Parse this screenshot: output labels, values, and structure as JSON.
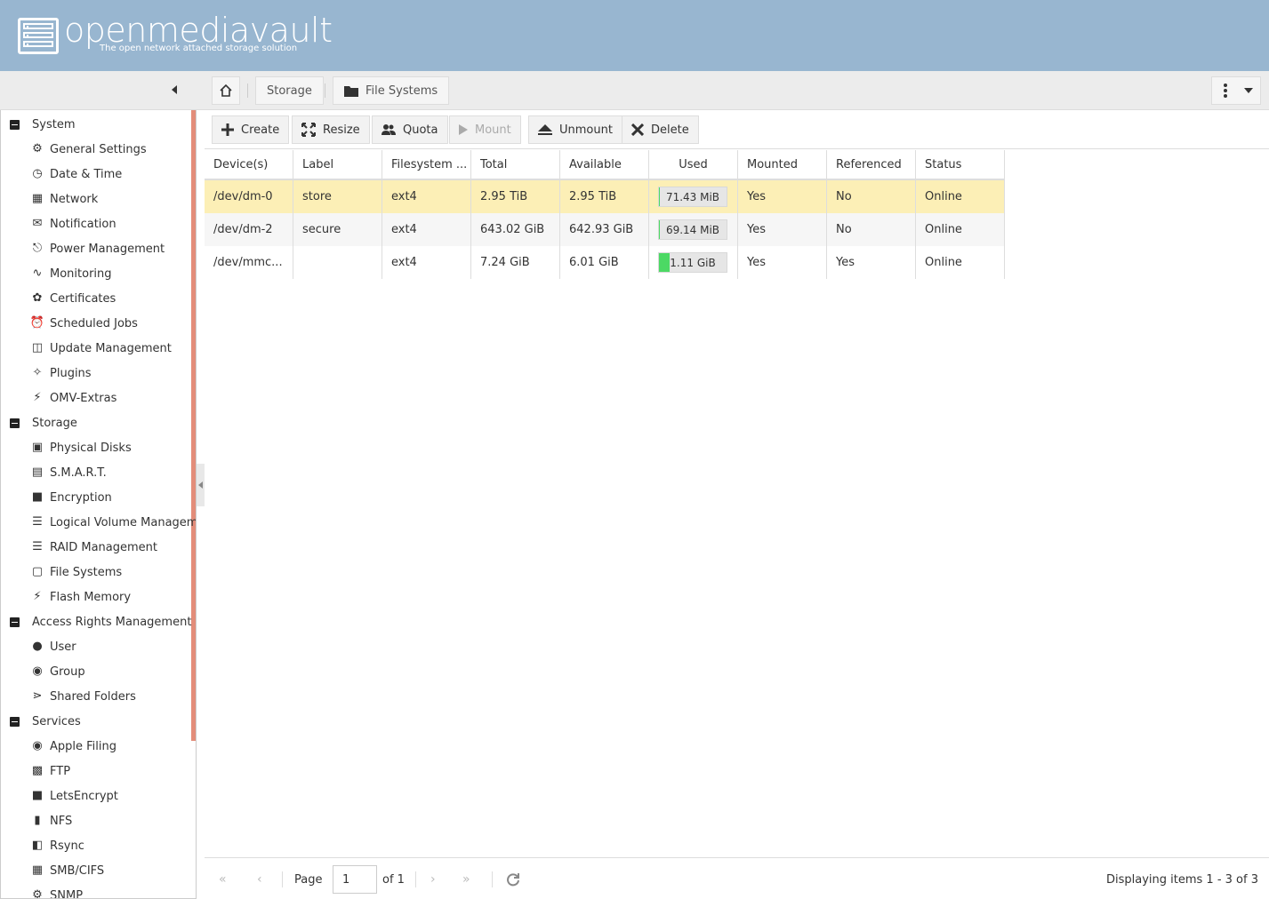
{
  "header": {
    "title": "openmediavault",
    "subtitle": "The open network attached storage solution"
  },
  "breadcrumb": {
    "home_icon": "home-icon",
    "items": [
      "Storage",
      "File Systems"
    ]
  },
  "sidebar": {
    "categories": [
      {
        "label": "System",
        "items": [
          {
            "label": "General Settings",
            "icon": "gears-icon"
          },
          {
            "label": "Date & Time",
            "icon": "clock-icon"
          },
          {
            "label": "Network",
            "icon": "network-icon"
          },
          {
            "label": "Notification",
            "icon": "envelope-icon"
          },
          {
            "label": "Power Management",
            "icon": "power-icon"
          },
          {
            "label": "Monitoring",
            "icon": "chart-line-icon"
          },
          {
            "label": "Certificates",
            "icon": "certificate-icon"
          },
          {
            "label": "Scheduled Jobs",
            "icon": "alarm-clock-icon"
          },
          {
            "label": "Update Management",
            "icon": "update-icon"
          },
          {
            "label": "Plugins",
            "icon": "puzzle-icon"
          },
          {
            "label": "OMV-Extras",
            "icon": "plug-icon"
          }
        ]
      },
      {
        "label": "Storage",
        "items": [
          {
            "label": "Physical Disks",
            "icon": "hdd-icon"
          },
          {
            "label": "S.M.A.R.T.",
            "icon": "smart-icon"
          },
          {
            "label": "Encryption",
            "icon": "lock-icon"
          },
          {
            "label": "Logical Volume Managem",
            "icon": "database-icon"
          },
          {
            "label": "RAID Management",
            "icon": "database-icon"
          },
          {
            "label": "File Systems",
            "icon": "folder-icon"
          },
          {
            "label": "Flash Memory",
            "icon": "flash-icon"
          }
        ]
      },
      {
        "label": "Access Rights Management",
        "items": [
          {
            "label": "User",
            "icon": "user-icon"
          },
          {
            "label": "Group",
            "icon": "group-icon"
          },
          {
            "label": "Shared Folders",
            "icon": "share-icon"
          }
        ]
      },
      {
        "label": "Services",
        "items": [
          {
            "label": "Apple Filing",
            "icon": "apple-icon"
          },
          {
            "label": "FTP",
            "icon": "ftp-icon"
          },
          {
            "label": "LetsEncrypt",
            "icon": "lock-icon"
          },
          {
            "label": "NFS",
            "icon": "file-icon"
          },
          {
            "label": "Rsync",
            "icon": "rsync-icon"
          },
          {
            "label": "SMB/CIFS",
            "icon": "windows-icon"
          },
          {
            "label": "SNMP",
            "icon": "gear-icon"
          }
        ]
      }
    ]
  },
  "toolbar": {
    "buttons": [
      {
        "label": "Create",
        "icon": "plus-icon",
        "enabled": true
      },
      {
        "label": "Resize",
        "icon": "expand-icon",
        "enabled": true
      },
      {
        "label": "Quota",
        "icon": "users-icon",
        "enabled": true
      },
      {
        "label": "Mount",
        "icon": "play-icon",
        "enabled": false
      },
      {
        "label": "Unmount",
        "icon": "eject-icon",
        "enabled": true
      },
      {
        "label": "Delete",
        "icon": "close-icon",
        "enabled": true
      }
    ]
  },
  "grid": {
    "columns": [
      "Device(s)",
      "Label",
      "Filesystem ...",
      "Total",
      "Available",
      "Used",
      "Mounted",
      "Referenced",
      "Status"
    ],
    "rows": [
      {
        "device": "/dev/dm-0",
        "label": "store",
        "fs": "ext4",
        "total": "2.95 TiB",
        "available": "2.95 TiB",
        "used": "71.43 MiB",
        "used_fraction": 0.01,
        "mounted": "Yes",
        "referenced": "No",
        "status": "Online",
        "selected": true
      },
      {
        "device": "/dev/dm-2",
        "label": "secure",
        "fs": "ext4",
        "total": "643.02 GiB",
        "available": "642.93 GiB",
        "used": "69.14 MiB",
        "used_fraction": 0.01,
        "mounted": "Yes",
        "referenced": "No",
        "status": "Online",
        "selected": false
      },
      {
        "device": "/dev/mmc...",
        "label": "",
        "fs": "ext4",
        "total": "7.24 GiB",
        "available": "6.01 GiB",
        "used": "1.11 GiB",
        "used_fraction": 0.16,
        "mounted": "Yes",
        "referenced": "Yes",
        "status": "Online",
        "selected": false
      }
    ]
  },
  "pager": {
    "page_label": "Page",
    "page_value": "1",
    "of_label": "of 1",
    "display_text": "Displaying items 1 - 3 of 3"
  },
  "colors": {
    "header": "#98b6d0",
    "selected_row": "#fcefb6",
    "used_fill": "#4cd964",
    "sidebar_scroll": "#e38d7a"
  }
}
